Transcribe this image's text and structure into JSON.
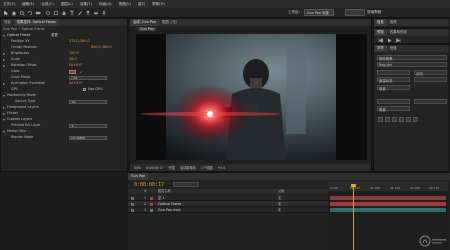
{
  "menu": [
    "文件(F)",
    "编辑(E)",
    "合成(C)",
    "图层(L)",
    "效果(T)",
    "动画(A)",
    "视图(V)",
    "窗口",
    "帮助(H)"
  ],
  "toolbar": {
    "workspace_label": "工作区:",
    "workspace_value": "Gun Pan 标准",
    "search_help": "搜索帮助"
  },
  "effect_panel": {
    "tabs": [
      "项目",
      "效果控件: Optical Flares"
    ],
    "path": "Gun Pan • Optical Flares",
    "rows": [
      {
        "label": "Optical Flares",
        "value": "重置",
        "value2": ""
      },
      {
        "label": "Position XY",
        "value": "372.0,389.0",
        "value2": ""
      },
      {
        "label": "Center Position",
        "value": "",
        "value2": "640.0,360.0"
      },
      {
        "label": "Brightness",
        "value": "100.0",
        "value2": ""
      },
      {
        "label": "Scale",
        "value": "38.0",
        "value2": ""
      },
      {
        "label": "Rotation Offset",
        "value": "0x+0.0°",
        "value2": ""
      },
      {
        "label": "Color",
        "value": "",
        "value2": ""
      },
      {
        "label": "Color Mode",
        "value": "Tint",
        "value2": ""
      },
      {
        "label": "Animation Evolution",
        "value": "0x+0.0°",
        "value2": ""
      },
      {
        "label": "GPU",
        "value": "",
        "value2": "Use GPU"
      },
      {
        "label": "Positioning Mode",
        "value": "",
        "value2": ""
      },
      {
        "label": "Source Type",
        "value": "3D",
        "value2": ""
      },
      {
        "label": "Foreground Layers",
        "value": "",
        "value2": ""
      },
      {
        "label": "Flicker",
        "value": "",
        "value2": ""
      },
      {
        "label": "Custom Layers",
        "value": "",
        "value2": ""
      },
      {
        "label": "Preview BG Layer",
        "value": "无",
        "value2": ""
      },
      {
        "label": "Motion Blur",
        "value": "",
        "value2": ""
      },
      {
        "label": "Render Mode",
        "value": "On Black",
        "value2": ""
      }
    ]
  },
  "comp_panel": {
    "tabs": [
      "合成: Gun Pan",
      "图层: (无)"
    ],
    "inner_tab": "Gun Pan",
    "footer": [
      "50%",
      "0:00:00:17",
      "完整",
      "活动摄像机",
      "1个视图",
      "+0.0"
    ]
  },
  "right_panel": {
    "info_tabs": [
      "信息",
      "音频"
    ],
    "preview_tabs": [
      "预览",
      "效果和预设"
    ],
    "char_tabs": [
      "字符",
      "段落"
    ],
    "char_labels": [
      "微软雅黑",
      "Regular",
      "自动",
      "度量标准",
      "像素",
      "像素"
    ]
  },
  "timeline": {
    "tabs": [
      "Gun Pan"
    ],
    "timecode": "0:00:00:17",
    "header": [
      "#",
      "图层名称",
      "父级"
    ],
    "layers": [
      {
        "num": "1",
        "name": "空 1",
        "color": "#c9c9c9",
        "mode": "无"
      },
      {
        "num": "2",
        "name": "Optical Flares",
        "color": "#c9c9c9",
        "mode": "无"
      },
      {
        "num": "3",
        "name": "Gun Pan.mov",
        "color": "#c9c9c9",
        "mode": "无"
      }
    ],
    "ruler": [
      "0:00f",
      "00:12f",
      "01:00f",
      "01:12f",
      "02:00f",
      "02:12f"
    ]
  },
  "colors": {
    "accent": "#e0a528",
    "layer_red": "#b23a3a",
    "track_teal": "#2f6f6a"
  }
}
